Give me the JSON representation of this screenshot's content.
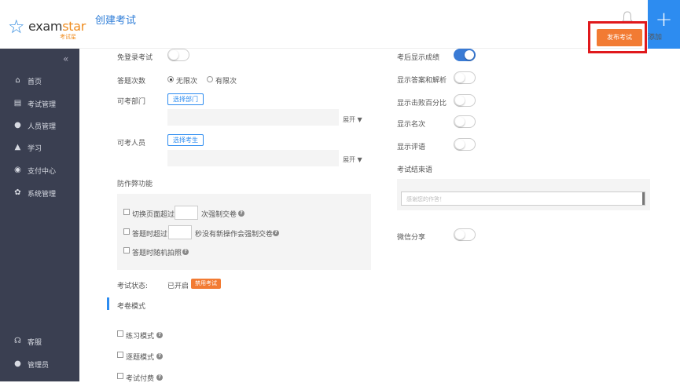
{
  "header": {
    "logo_text_a": "exam",
    "logo_text_b": "star",
    "logo_sub": "考试星",
    "page_title": "创建考试",
    "publish_label": "发布考试",
    "add_label": "添加",
    "add_symbol": "+"
  },
  "sidebar": {
    "collapse_symbol": "«",
    "items": [
      {
        "label": "首页",
        "icon": "home-icon"
      },
      {
        "label": "考试管理",
        "icon": "document-icon"
      },
      {
        "label": "人员管理",
        "icon": "users-icon"
      },
      {
        "label": "学习",
        "icon": "graduation-cap-icon"
      },
      {
        "label": "支付中心",
        "icon": "payment-icon"
      },
      {
        "label": "系统管理",
        "icon": "gears-icon"
      }
    ],
    "bottom": [
      {
        "label": "客服",
        "icon": "headset-icon"
      },
      {
        "label": "管理员",
        "icon": "user-icon"
      }
    ]
  },
  "form": {
    "no_login": "免登录考试",
    "attempts_label": "答题次数",
    "attempts_unlimited": "无限次",
    "attempts_limited": "有限次",
    "dept_label": "可考部门",
    "dept_button": "选择部门",
    "expand": "展开",
    "people_label": "可考人员",
    "people_button": "选择考生",
    "anticheat_title": "防作弊功能",
    "switch_page_a": "切换页面超过",
    "switch_page_b": "次强制交卷",
    "idle_a": "答题时超过",
    "idle_b": "秒没有新操作会强制交卷",
    "random_photo": "答题时随机拍照",
    "status_label": "考试状态:",
    "status_value": "已开启",
    "disable_button": "禁用考试",
    "mode_title": "考卷模式",
    "practice_mode": "练习模式",
    "one_by_one_mode": "逐题模式",
    "paid_exam": "考试付费",
    "help_symbol": "?"
  },
  "right": {
    "show_score": "考后显示成绩",
    "show_answer": "显示答案和解析",
    "show_beat": "显示击败百分比",
    "show_rank": "显示名次",
    "show_comment": "显示评语",
    "end_message_label": "考试结束语",
    "end_message_placeholder": "感谢您的作答！",
    "wechat_share": "微信分享"
  },
  "toggles": {
    "no_login": false,
    "show_score": true,
    "show_answer": false,
    "show_beat": false,
    "show_rank": false,
    "show_comment": false,
    "wechat_share": false
  },
  "colors": {
    "sidebar_bg": "#3a3f51",
    "accent_blue": "#2d8cf0",
    "accent_orange": "#f27b33",
    "highlight_red": "#e0191c"
  }
}
